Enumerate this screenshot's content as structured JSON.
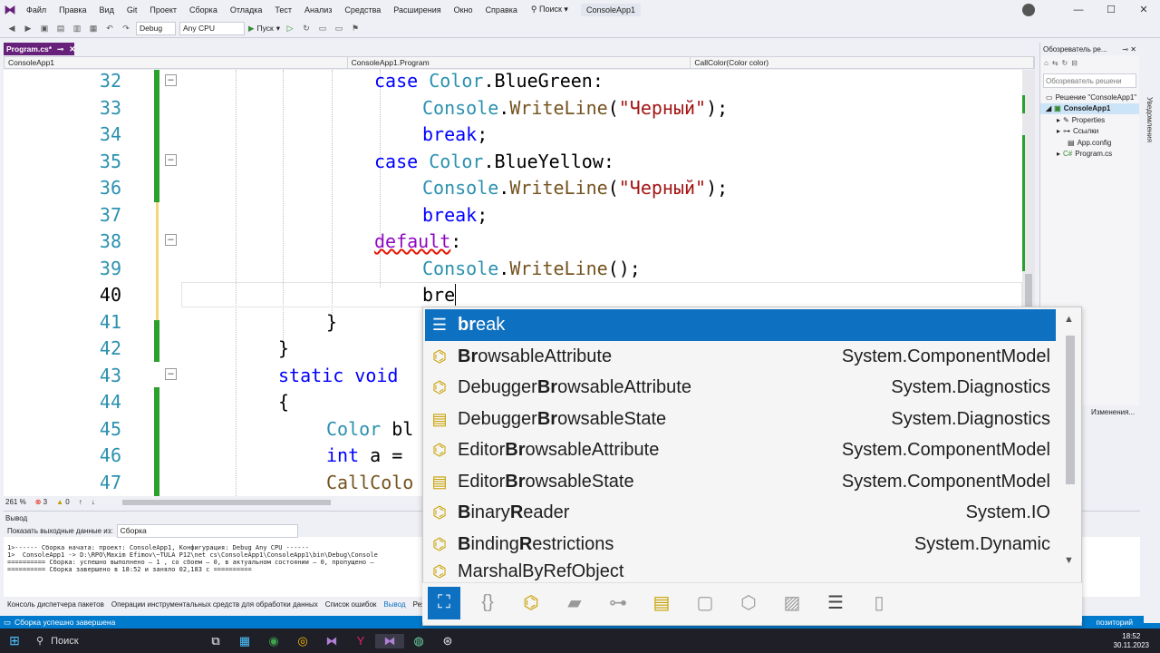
{
  "menu": {
    "items": [
      "Файл",
      "Правка",
      "Вид",
      "Git",
      "Проект",
      "Сборка",
      "Отладка",
      "Тест",
      "Анализ",
      "Средства",
      "Расширения",
      "Окно",
      "Справка"
    ],
    "search_label": "Поиск",
    "app_name": "ConsoleApp1"
  },
  "toolbar": {
    "config": "Debug",
    "platform": "Any CPU",
    "run_label": "Пуск"
  },
  "document_tab": "Program.cs*",
  "navbar": {
    "project": "ConsoleApp1",
    "class": "ConsoleApp1.Program",
    "member": "CallColor(Color color)"
  },
  "code_lines": [
    {
      "num": "32"
    },
    {
      "num": "33"
    },
    {
      "num": "34"
    },
    {
      "num": "35"
    },
    {
      "num": "36"
    },
    {
      "num": "37"
    },
    {
      "num": "38"
    },
    {
      "num": "39"
    },
    {
      "num": "40"
    },
    {
      "num": "41"
    },
    {
      "num": "42"
    },
    {
      "num": "43"
    },
    {
      "num": "44"
    },
    {
      "num": "45"
    },
    {
      "num": "46"
    },
    {
      "num": "47"
    }
  ],
  "code": {
    "l32a": "case ",
    "l32b": "Color",
    "l32c": ".BlueGreen:",
    "l33a": "Console",
    "l33b": ".",
    "l33c": "WriteLine",
    "l33d": "(",
    "l33e": "\"Черный\"",
    "l33f": ");",
    "l34a": "break",
    "l34b": ";",
    "l35a": "case ",
    "l35b": "Color",
    "l35c": ".BlueYellow:",
    "l36a": "Console",
    "l36b": ".",
    "l36c": "WriteLine",
    "l36d": "(",
    "l36e": "\"Черный\"",
    "l36f": ");",
    "l37a": "break",
    "l37b": ";",
    "l38a": "default",
    "l38b": ":",
    "l39a": "Console",
    "l39b": ".",
    "l39c": "WriteLine",
    "l39d": "();",
    "l40a": "bre",
    "l41a": "}",
    "l42a": "}",
    "l43a": "static void",
    "l44a": "{",
    "l45a": "Color",
    "l45b": " bl",
    "l46a": "int",
    "l46b": " a =",
    "l47a": "CallColo"
  },
  "editor_status": {
    "zoom": "261 %",
    "errors": "3",
    "warnings": "0"
  },
  "output": {
    "title": "Вывод",
    "show_label": "Показать выходные данные из:",
    "source": "Сборка",
    "lines": [
      "1>------ Сборка начата: проект: ConsoleApp1, Конфигурация: Debug Any CPU ------",
      "1>  ConsoleApp1 -> D:\\RPO\\Maxim Efimov\\~TULA P12\\net cs\\ConsoleApp1\\ConsoleApp1\\bin\\Debug\\Console",
      "========== Сборка: успешно выполнено — 1 , со сбоем — 0, в актуальном состоянии — 0, пропущено —",
      "========== Сборка завершено в 18:52 и заняло 02,183 с =========="
    ]
  },
  "bottom_tabs": [
    "Консоль диспетчера пакетов",
    "Операции инструментальных средств для обработки данных",
    "Список ошибок",
    "Вывод",
    "Рез"
  ],
  "status_text": "Сборка успешно завершена",
  "status_right": "позиторий",
  "solution_explorer": {
    "title": "Обозреватель ре...",
    "search_placeholder": "Обозреватель решени",
    "nodes": [
      "Решение \"ConsoleApp1\"",
      "ConsoleApp1",
      "Properties",
      "Ссылки",
      "App.config",
      "Program.cs"
    ],
    "props_label": "Изменения..."
  },
  "notifications_label": "Уведомления",
  "completion": {
    "items": [
      {
        "pre": "",
        "bold": "br",
        "rest": "eak",
        "ns": "",
        "icon": "keyword-icon"
      },
      {
        "pre": "",
        "bold": "Br",
        "rest": "owsableAttribute",
        "ns": "System.ComponentModel",
        "icon": "class-icon"
      },
      {
        "pre": "Debugger",
        "bold": "Br",
        "rest": "owsableAttribute",
        "ns": "System.Diagnostics",
        "icon": "class-icon"
      },
      {
        "pre": "Debugger",
        "bold": "Br",
        "rest": "owsableState",
        "ns": "System.Diagnostics",
        "icon": "enum-icon"
      },
      {
        "pre": "Editor",
        "bold": "Br",
        "rest": "owsableAttribute",
        "ns": "System.ComponentModel",
        "icon": "class-icon"
      },
      {
        "pre": "Editor",
        "bold": "Br",
        "rest": "owsableState",
        "ns": "System.ComponentModel",
        "icon": "enum-icon"
      },
      {
        "pre": "",
        "bold": "B",
        "rest": "inary",
        "bold2": "R",
        "rest2": "eader",
        "ns": "System.IO",
        "icon": "class-icon"
      },
      {
        "pre": "",
        "bold": "B",
        "rest": "inding",
        "bold2": "R",
        "rest2": "estrictions",
        "ns": "System.Dynamic",
        "icon": "class-icon"
      },
      {
        "pre": "",
        "bold": "",
        "rest": "MarshalByRefObject",
        "ns": "",
        "icon": "class-icon"
      }
    ]
  },
  "taskbar": {
    "search_label": "Поиск",
    "time": "18:52",
    "date": "30.11.2023"
  }
}
